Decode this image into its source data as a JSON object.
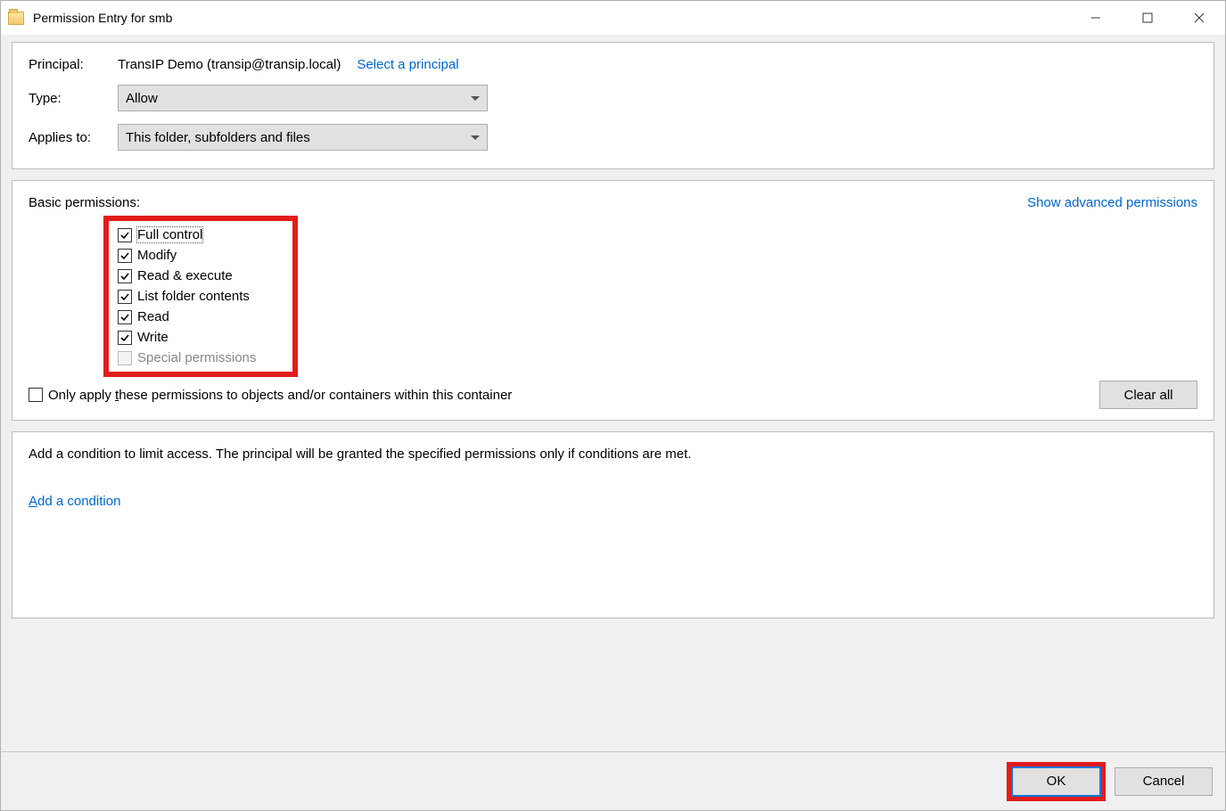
{
  "window": {
    "title": "Permission Entry for smb"
  },
  "principal": {
    "label": "Principal:",
    "value": "TransIP Demo (transip@transip.local)",
    "select_link": "Select a principal"
  },
  "type": {
    "label": "Type:",
    "value": "Allow"
  },
  "applies_to": {
    "label": "Applies to:",
    "value": "This folder, subfolders and files"
  },
  "permissions": {
    "header": "Basic permissions:",
    "advanced_link": "Show advanced permissions",
    "items": [
      {
        "label": "Full control",
        "checked": true,
        "disabled": false,
        "focused": true
      },
      {
        "label": "Modify",
        "checked": true,
        "disabled": false,
        "focused": false
      },
      {
        "label": "Read & execute",
        "checked": true,
        "disabled": false,
        "focused": false
      },
      {
        "label": "List folder contents",
        "checked": true,
        "disabled": false,
        "focused": false
      },
      {
        "label": "Read",
        "checked": true,
        "disabled": false,
        "focused": false
      },
      {
        "label": "Write",
        "checked": true,
        "disabled": false,
        "focused": false
      },
      {
        "label": "Special permissions",
        "checked": false,
        "disabled": true,
        "focused": false
      }
    ],
    "only_apply_prefix": "Only apply ",
    "only_apply_u": "t",
    "only_apply_suffix": "hese permissions to objects and/or containers within this container",
    "clear_all": "Clear all"
  },
  "condition": {
    "description": "Add a condition to limit access. The principal will be granted the specified permissions only if conditions are met.",
    "add_link_u": "A",
    "add_link_suffix": "dd a condition"
  },
  "footer": {
    "ok": "OK",
    "cancel": "Cancel"
  }
}
